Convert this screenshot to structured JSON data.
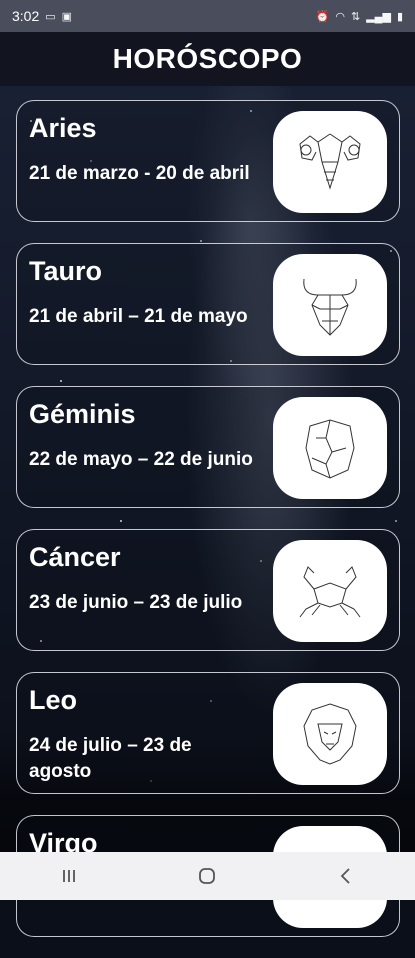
{
  "status_bar": {
    "time": "3:02",
    "left_icons": [
      "laptop-icon",
      "photo-icon"
    ],
    "right_icons": [
      "alarm-icon",
      "wifi-icon",
      "data-icon",
      "signal-icon",
      "battery-icon"
    ]
  },
  "header": {
    "title": "HORÓSCOPO"
  },
  "signs": [
    {
      "name": "Aries",
      "dates": "21 de marzo  - 20 de abril",
      "icon": "aries-ram-icon"
    },
    {
      "name": "Tauro",
      "dates": "21 de abril – 21 de mayo",
      "icon": "taurus-bull-icon"
    },
    {
      "name": "Géminis",
      "dates": "22 de mayo – 22 de junio",
      "icon": "gemini-twins-icon"
    },
    {
      "name": "Cáncer",
      "dates": "23 de junio – 23 de julio",
      "icon": "cancer-crab-icon"
    },
    {
      "name": "Leo",
      "dates": "24 de julio – 23 de agosto",
      "icon": "leo-lion-icon"
    },
    {
      "name": "Virgo",
      "dates": "",
      "icon": "virgo-icon"
    }
  ],
  "nav": {
    "buttons": [
      "recent-apps-icon",
      "home-icon",
      "back-icon"
    ]
  },
  "colors": {
    "card_border": "#e6e6f0",
    "header_bg": "#12141f",
    "nav_bg": "#f1f1f3"
  }
}
